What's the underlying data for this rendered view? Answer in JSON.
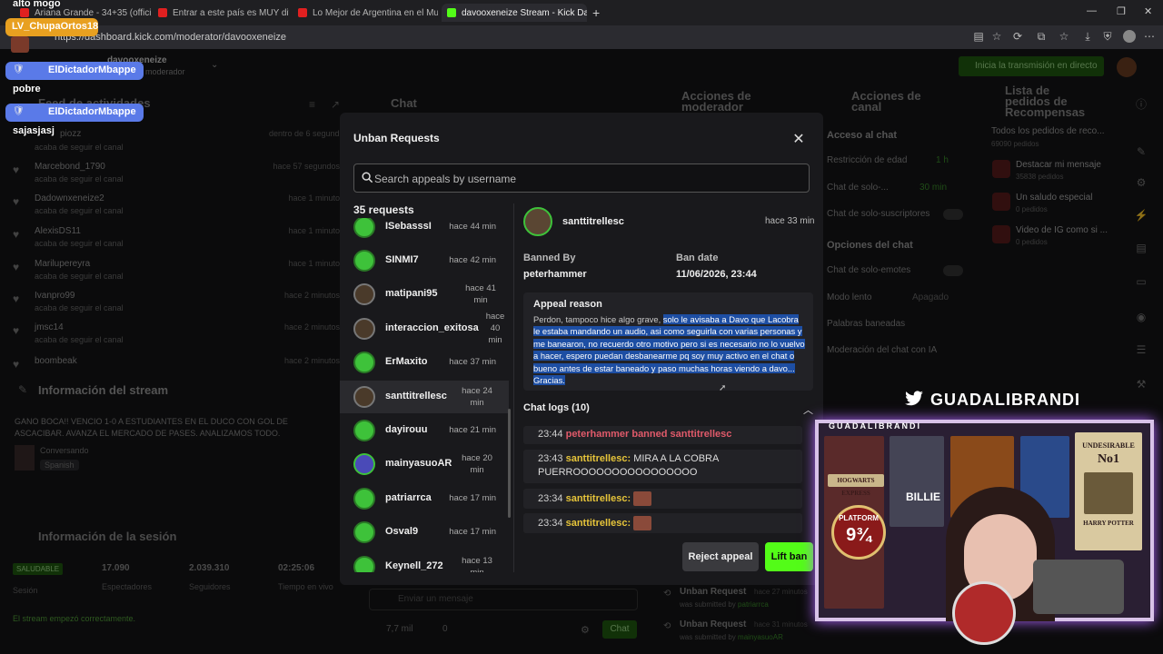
{
  "browser": {
    "tabs": [
      {
        "label": "Ariana Grande - 34+35 (offici",
        "color": "#e02020"
      },
      {
        "label": "Entrar a este país es MUY difícil y",
        "color": "#e02020"
      },
      {
        "label": "Lo Mejor de Argentina en el Mun",
        "color": "#e02020"
      },
      {
        "label": "davooxeneize Stream - Kick Dashb",
        "color": "#53fc18"
      }
    ],
    "url": "https://dashboard.kick.com/moderator/davooxeneize"
  },
  "dashboard": {
    "channel": "davooxeneize",
    "role": "moderador",
    "go_live": "Inicia la transmisión en directo",
    "activity_title": "Feed de actividades",
    "activity": [
      {
        "name": "Marcebond_1790",
        "sub": "acaba de seguir el canal",
        "time": "hace 57 segundos"
      },
      {
        "name": "Dadownxeneize2",
        "sub": "acaba de seguir el canal",
        "time": "hace 1 minuto"
      },
      {
        "name": "AlexisDS11",
        "sub": "acaba de seguir el canal",
        "time": "hace 1 minuto"
      },
      {
        "name": "Marilupereyra",
        "sub": "acaba de seguir el canal",
        "time": "hace 1 minuto"
      },
      {
        "name": "Ivanpro99",
        "sub": "acaba de seguir el canal",
        "time": "hace 2 minutos"
      },
      {
        "name": "jmsc14",
        "sub": "acaba de seguir el canal",
        "time": "hace 2 minutos"
      },
      {
        "name": "boombeak",
        "sub": "",
        "time": "hace 2 minutos"
      }
    ],
    "first_activity": {
      "name": "piozz",
      "time": "dentro de 6 segundos"
    },
    "chat_title": "Chat",
    "modactions_title": "Acciones de moderador",
    "channelactions_title": "Acciones de canal",
    "rewards_title": "Lista de pedidos de Recompensas",
    "chat_access": "Acceso al chat",
    "chan_rows": [
      {
        "label": "Restricción de edad",
        "value": "1 h"
      },
      {
        "label": "Chat de solo-...",
        "value": "30 min"
      },
      {
        "label": "Chat de solo-suscriptores",
        "value": ""
      }
    ],
    "chat_options": "Opciones del chat",
    "chan_rows2": [
      {
        "label": "Chat de solo-emotes",
        "value": ""
      },
      {
        "label": "Modo lento",
        "value": "Apagado"
      },
      {
        "label": "Palabras baneadas",
        "value": ""
      },
      {
        "label": "Moderación del chat con IA",
        "value": ""
      }
    ],
    "rewards_all": "Todos los pedidos de reco...",
    "rewards_all_sub": "69090 pedidos",
    "rewards": [
      {
        "title": "Destacar mi mensaje",
        "sub": "35838 pedidos"
      },
      {
        "title": "Un saludo especial",
        "sub": "0 pedidos"
      },
      {
        "title": "Video de IG como si ...",
        "sub": "0 pedidos"
      }
    ],
    "stream_info_title": "Información del stream",
    "stream_title": "GANO BOCA!! VENCIO 1-0 A ESTUDIANTES EN EL DUCO CON GOL DE ASCACIBAR. AVANZA EL MERCADO DE PASES. ANALIZAMOS TODO.",
    "category": "Conversando",
    "language": "Spanish",
    "session_title": "Información de la sesión",
    "health": "SALUDABLE",
    "health_label": "Sesión",
    "stats": [
      {
        "value": "17.090",
        "label": "Espectadores"
      },
      {
        "value": "2.039.310",
        "label": "Seguidores"
      },
      {
        "value": "02:25:06",
        "label": "Tiempo en vivo"
      }
    ],
    "stream_ok": "El stream empezó correctamente.",
    "chat_placeholder": "Enviar un mensaje",
    "chat_viewers": "7,7 mil",
    "chat_zero": "0",
    "chat_send": "Chat",
    "mod_log": [
      {
        "title": "Unban Request",
        "time": "hace 27 minutos",
        "sub": "was submitted by",
        "user": "patriarrca"
      },
      {
        "title": "Unban Request",
        "time": "hace 31 minutos",
        "sub": "was submitted by",
        "user": "mainyasuoAR"
      }
    ]
  },
  "modal": {
    "title": "Unban Requests",
    "search_placeholder": "Search appeals by username",
    "count": "35 requests",
    "requests": [
      {
        "user": "ISebasssI",
        "time": "hace 44 min"
      },
      {
        "user": "SINMI7",
        "time": "hace 42 min"
      },
      {
        "user": "matipani95",
        "time": "hace 41 min"
      },
      {
        "user": "interaccion_exitosa",
        "time": "hace 40 min"
      },
      {
        "user": "ErMaxito",
        "time": "hace 37 min"
      },
      {
        "user": "santtitrellesc",
        "time": "hace 24 min"
      },
      {
        "user": "dayirouu",
        "time": "hace 21 min"
      },
      {
        "user": "mainyasuoAR",
        "time": "hace 20 min"
      },
      {
        "user": "patriarrca",
        "time": "hace 17 min"
      },
      {
        "user": "Osval9",
        "time": "hace 17 min"
      },
      {
        "user": "Keynell_272",
        "time": "hace 13 min"
      }
    ],
    "detail": {
      "user": "santtitrellesc",
      "time": "hace 33 min",
      "banned_by_label": "Banned By",
      "banned_by": "peterhammer",
      "ban_date_label": "Ban date",
      "ban_date": "11/06/2026, 23:44",
      "appeal_label": "Appeal reason",
      "appeal_plain": "Perdon, tampoco hice algo grave, ",
      "appeal_highlight": "solo le avisaba a Davo que Lacobra le estaba mandando un audio, asi como seguirla con varias personas y me banearon, no recuerdo otro motivo pero si es necesario no lo vuelvo a hacer, espero puedan desbanearme pq soy muy activo en el chat o bueno antes de estar baneado y paso muchas horas viendo a davo... Gracias.",
      "logs_label": "Chat logs (10)",
      "logs": [
        {
          "time": "23:44",
          "text": "peterhammer banned santtitrellesc"
        },
        {
          "time": "23:43",
          "user": "santtitrellesc:",
          "text": "MIRA A LA COBRA PUERROOOOOOOOOOOOOOOO"
        },
        {
          "time": "23:34",
          "user": "santtitrellesc:",
          "text": ""
        },
        {
          "time": "23:34",
          "user": "santtitrellesc:",
          "text": ""
        }
      ],
      "reject_label": "Reject appeal",
      "lift_label": "Lift ban"
    }
  },
  "overlay": {
    "twitter_handle": "GUADALIBRANDI",
    "cam_label": "GUADALIBRANDI",
    "chat": [
      {
        "user": "",
        "msg": "alto mogo"
      },
      {
        "user": "LV_ChupaOrtos18",
        "msg": "",
        "color": "#e8a020"
      },
      {
        "user": "ElDictadorMbappe",
        "msg": "pobre",
        "color": "#5a7ae8"
      },
      {
        "user": "ElDictadorMbappe",
        "msg": "sajasjasj",
        "color": "#5a7ae8"
      }
    ],
    "posters": [
      "HOGWARTS EXPRESS",
      "PLATFORM",
      "9¾",
      "BILLIE",
      "UNDESIRABLE",
      "No1",
      "HARRY POTTER"
    ]
  }
}
